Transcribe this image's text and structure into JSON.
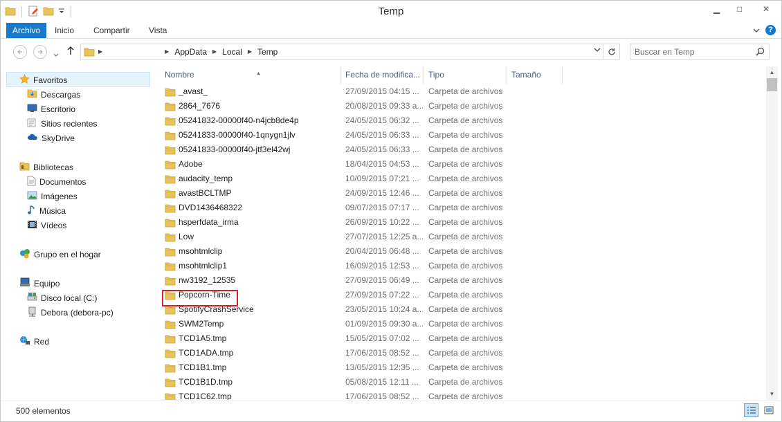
{
  "window": {
    "title": "Temp",
    "controls": {
      "minimize": "▁",
      "maximize": "□",
      "close": "✕"
    }
  },
  "ribbon": {
    "tabs": [
      "Archivo",
      "Inicio",
      "Compartir",
      "Vista"
    ],
    "help": "?"
  },
  "address": {
    "crumbs": [
      "AppData",
      "Local",
      "Temp"
    ]
  },
  "search": {
    "placeholder": "Buscar en Temp"
  },
  "nav": {
    "favorites": {
      "label": "Favoritos",
      "items": [
        "Descargas",
        "Escritorio",
        "Sitios recientes",
        "SkyDrive"
      ]
    },
    "libraries": {
      "label": "Bibliotecas",
      "items": [
        "Documentos",
        "Imágenes",
        "Música",
        "Vídeos"
      ]
    },
    "homegroup": {
      "label": "Grupo en el hogar"
    },
    "computer": {
      "label": "Equipo",
      "items": [
        "Disco local (C:)",
        "Debora (debora-pc)"
      ]
    },
    "network": {
      "label": "Red"
    }
  },
  "columns": [
    "Nombre",
    "Fecha de modifica...",
    "Tipo",
    "Tamaño"
  ],
  "files": [
    {
      "name": "_avast_",
      "date": "27/09/2015 04:15 ...",
      "type": "Carpeta de archivos"
    },
    {
      "name": "2864_7676",
      "date": "20/08/2015 09:33 a...",
      "type": "Carpeta de archivos"
    },
    {
      "name": "05241832-00000f40-n4jcb8de4p",
      "date": "24/05/2015 06:32 ...",
      "type": "Carpeta de archivos"
    },
    {
      "name": "05241833-00000f40-1qnygn1jlv",
      "date": "24/05/2015 06:33 ...",
      "type": "Carpeta de archivos"
    },
    {
      "name": "05241833-00000f40-jtf3el42wj",
      "date": "24/05/2015 06:33 ...",
      "type": "Carpeta de archivos"
    },
    {
      "name": "Adobe",
      "date": "18/04/2015 04:53 ...",
      "type": "Carpeta de archivos"
    },
    {
      "name": "audacity_temp",
      "date": "10/09/2015 07:21 ...",
      "type": "Carpeta de archivos"
    },
    {
      "name": "avastBCLTMP",
      "date": "24/09/2015 12:46 ...",
      "type": "Carpeta de archivos"
    },
    {
      "name": "DVD1436468322",
      "date": "09/07/2015 07:17 ...",
      "type": "Carpeta de archivos"
    },
    {
      "name": "hsperfdata_irma",
      "date": "26/09/2015 10:22 ...",
      "type": "Carpeta de archivos"
    },
    {
      "name": "Low",
      "date": "27/07/2015 12:25 a...",
      "type": "Carpeta de archivos"
    },
    {
      "name": "msohtmlclip",
      "date": "20/04/2015 06:48 ...",
      "type": "Carpeta de archivos"
    },
    {
      "name": "msohtmlclip1",
      "date": "16/09/2015 12:53 ...",
      "type": "Carpeta de archivos"
    },
    {
      "name": "nw3192_12535",
      "date": "27/09/2015 06:49 ...",
      "type": "Carpeta de archivos"
    },
    {
      "name": "Popcorn-Time",
      "date": "27/09/2015 07:22 ...",
      "type": "Carpeta de archivos"
    },
    {
      "name": "SpotifyCrashService",
      "date": "23/05/2015 10:24 a...",
      "type": "Carpeta de archivos"
    },
    {
      "name": "SWM2Temp",
      "date": "01/09/2015 09:30 a...",
      "type": "Carpeta de archivos"
    },
    {
      "name": "TCD1A5.tmp",
      "date": "15/05/2015 07:02 ...",
      "type": "Carpeta de archivos"
    },
    {
      "name": "TCD1ADA.tmp",
      "date": "17/06/2015 08:52 ...",
      "type": "Carpeta de archivos"
    },
    {
      "name": "TCD1B1.tmp",
      "date": "13/05/2015 12:35 ...",
      "type": "Carpeta de archivos"
    },
    {
      "name": "TCD1B1D.tmp",
      "date": "05/08/2015 12:11 ...",
      "type": "Carpeta de archivos"
    },
    {
      "name": "TCD1C62.tmp",
      "date": "17/06/2015 08:52 ...",
      "type": "Carpeta de archivos"
    }
  ],
  "status": {
    "count": "500 elementos"
  },
  "colors": {
    "accent": "#1979ca",
    "folder": "#e8c25a",
    "highlight_border": "#d0202a"
  },
  "icons": {
    "folder": "folder-icon",
    "star": "star-icon",
    "search": "search-icon"
  }
}
